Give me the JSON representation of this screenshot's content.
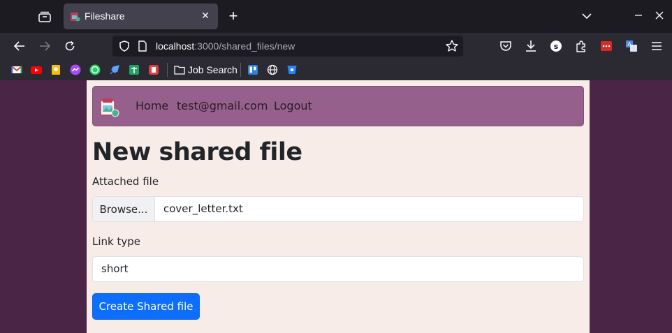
{
  "browser": {
    "tab": {
      "title": "Fileshare"
    },
    "url": {
      "host": "localhost",
      "rest": ":3000/shared_files/new"
    },
    "bookmarks": {
      "folder_label": "Job Search"
    }
  },
  "site": {
    "nav": {
      "home": "Home",
      "email": "test@gmail.com",
      "logout": "Logout"
    }
  },
  "form": {
    "title": "New shared file",
    "attached_label": "Attached file",
    "browse_label": "Browse...",
    "file_name": "cover_letter.txt",
    "link_type_label": "Link type",
    "link_type_value": "short",
    "submit_label": "Create Shared file"
  },
  "colors": {
    "page_bg": "#4a2545",
    "container_bg": "#f8ece8",
    "site_nav_bg": "#95618c",
    "primary": "#0d6efd"
  }
}
